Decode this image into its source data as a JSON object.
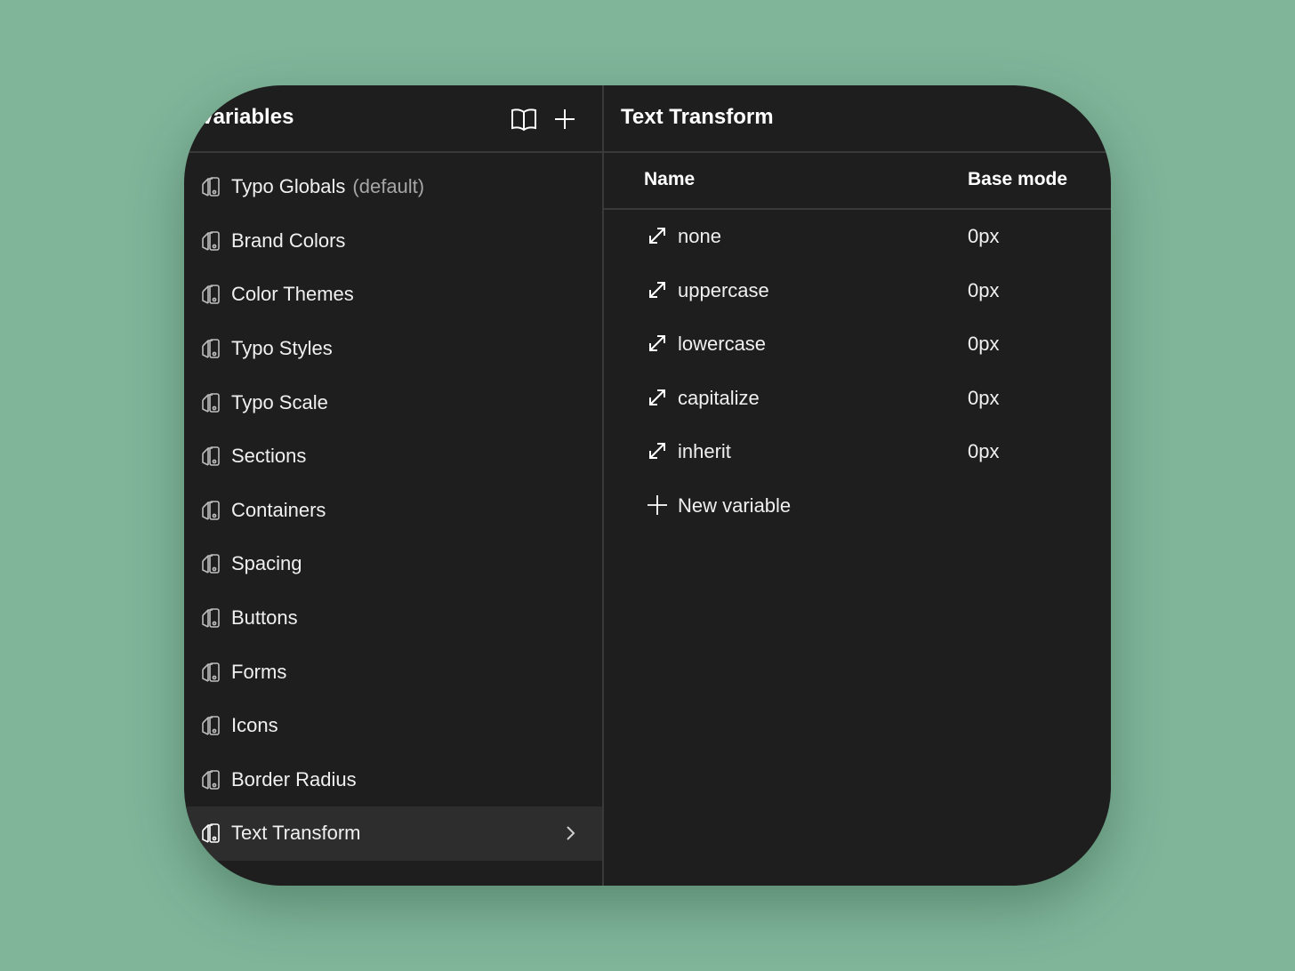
{
  "sidebar": {
    "title": "Variables",
    "collections": [
      {
        "label": "Typo Globals",
        "suffix": "(default)"
      },
      {
        "label": "Brand Colors"
      },
      {
        "label": "Color Themes"
      },
      {
        "label": "Typo Styles"
      },
      {
        "label": "Typo Scale"
      },
      {
        "label": "Sections"
      },
      {
        "label": "Containers"
      },
      {
        "label": "Spacing"
      },
      {
        "label": "Buttons"
      },
      {
        "label": "Forms"
      },
      {
        "label": "Icons"
      },
      {
        "label": "Border Radius"
      },
      {
        "label": "Text Transform",
        "active": true
      }
    ],
    "icons": {
      "docs": "book-icon",
      "add": "plus-icon",
      "collection": "collection-icon",
      "chevron": "chevron-right-icon"
    }
  },
  "main": {
    "title": "Text Transform",
    "columns": {
      "name": "Name",
      "base": "Base mode"
    },
    "variables": [
      {
        "name": "none",
        "value": "0px"
      },
      {
        "name": "uppercase",
        "value": "0px"
      },
      {
        "name": "lowercase",
        "value": "0px"
      },
      {
        "name": "capitalize",
        "value": "0px"
      },
      {
        "name": "inherit",
        "value": "0px"
      }
    ],
    "new_variable_label": "New variable",
    "variable_icon": "resize-diagonal-icon"
  },
  "colors": {
    "background": "#80b59a",
    "panel": "#1e1e1e",
    "active_row": "#2d2d2d",
    "divider": "#3a3a3a"
  }
}
